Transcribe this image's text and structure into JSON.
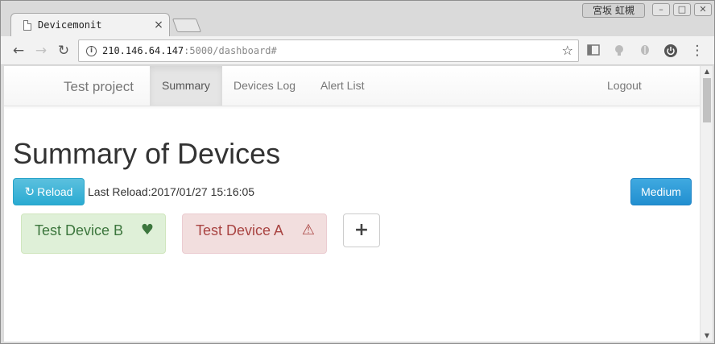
{
  "browser": {
    "tab_title": "Devicemonit",
    "tab_close": "×",
    "user_badge": "宮坂 虹槻",
    "window_buttons": {
      "minimize": "–",
      "maximize": "□",
      "close": "✕"
    },
    "nav": {
      "back": "←",
      "forward": "→",
      "reload": "↻",
      "menu": "⋮"
    },
    "url_host": "210.146.64.147",
    "url_rest": ":5000/dashboard#",
    "star": "☆",
    "extensions": [
      "sidebar-icon",
      "extension-icon",
      "shield-icon",
      "power-icon"
    ]
  },
  "navbar": {
    "brand": "Test project",
    "links": [
      "Summary",
      "Devices Log",
      "Alert List"
    ],
    "active": "Summary",
    "logout": "Logout"
  },
  "main": {
    "title": "Summary of Devices",
    "reload_icon": "↻",
    "reload_label": "Reload",
    "last_reload": "Last Reload:2017/01/27 15:16:05",
    "level_button": "Medium",
    "devices": [
      {
        "name": "Test Device B",
        "status": "ok",
        "status_icon": "♥",
        "color": "#3c763d"
      },
      {
        "name": "Test Device A",
        "status": "alert",
        "status_icon": "⚠",
        "color": "#a94442"
      }
    ],
    "add_label": "+"
  },
  "scrollbar": {
    "up": "▲",
    "down": "▼"
  }
}
